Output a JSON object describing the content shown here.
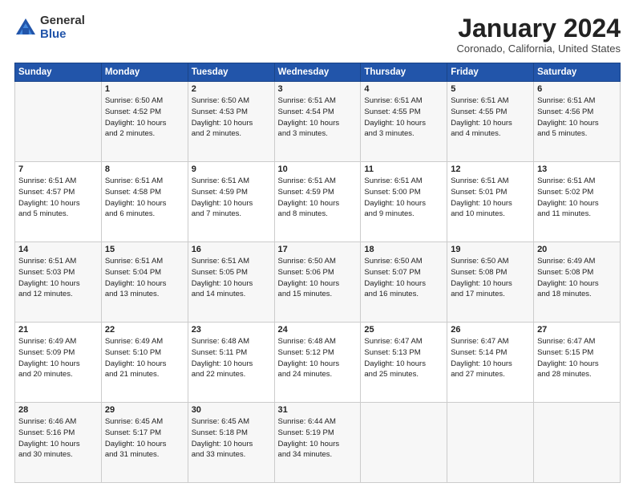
{
  "logo": {
    "general": "General",
    "blue": "Blue"
  },
  "title": "January 2024",
  "location": "Coronado, California, United States",
  "days_header": [
    "Sunday",
    "Monday",
    "Tuesday",
    "Wednesday",
    "Thursday",
    "Friday",
    "Saturday"
  ],
  "weeks": [
    [
      {
        "day": "",
        "info": ""
      },
      {
        "day": "1",
        "info": "Sunrise: 6:50 AM\nSunset: 4:52 PM\nDaylight: 10 hours\nand 2 minutes."
      },
      {
        "day": "2",
        "info": "Sunrise: 6:50 AM\nSunset: 4:53 PM\nDaylight: 10 hours\nand 2 minutes."
      },
      {
        "day": "3",
        "info": "Sunrise: 6:51 AM\nSunset: 4:54 PM\nDaylight: 10 hours\nand 3 minutes."
      },
      {
        "day": "4",
        "info": "Sunrise: 6:51 AM\nSunset: 4:55 PM\nDaylight: 10 hours\nand 3 minutes."
      },
      {
        "day": "5",
        "info": "Sunrise: 6:51 AM\nSunset: 4:55 PM\nDaylight: 10 hours\nand 4 minutes."
      },
      {
        "day": "6",
        "info": "Sunrise: 6:51 AM\nSunset: 4:56 PM\nDaylight: 10 hours\nand 5 minutes."
      }
    ],
    [
      {
        "day": "7",
        "info": "Sunrise: 6:51 AM\nSunset: 4:57 PM\nDaylight: 10 hours\nand 5 minutes."
      },
      {
        "day": "8",
        "info": "Sunrise: 6:51 AM\nSunset: 4:58 PM\nDaylight: 10 hours\nand 6 minutes."
      },
      {
        "day": "9",
        "info": "Sunrise: 6:51 AM\nSunset: 4:59 PM\nDaylight: 10 hours\nand 7 minutes."
      },
      {
        "day": "10",
        "info": "Sunrise: 6:51 AM\nSunset: 4:59 PM\nDaylight: 10 hours\nand 8 minutes."
      },
      {
        "day": "11",
        "info": "Sunrise: 6:51 AM\nSunset: 5:00 PM\nDaylight: 10 hours\nand 9 minutes."
      },
      {
        "day": "12",
        "info": "Sunrise: 6:51 AM\nSunset: 5:01 PM\nDaylight: 10 hours\nand 10 minutes."
      },
      {
        "day": "13",
        "info": "Sunrise: 6:51 AM\nSunset: 5:02 PM\nDaylight: 10 hours\nand 11 minutes."
      }
    ],
    [
      {
        "day": "14",
        "info": "Sunrise: 6:51 AM\nSunset: 5:03 PM\nDaylight: 10 hours\nand 12 minutes."
      },
      {
        "day": "15",
        "info": "Sunrise: 6:51 AM\nSunset: 5:04 PM\nDaylight: 10 hours\nand 13 minutes."
      },
      {
        "day": "16",
        "info": "Sunrise: 6:51 AM\nSunset: 5:05 PM\nDaylight: 10 hours\nand 14 minutes."
      },
      {
        "day": "17",
        "info": "Sunrise: 6:50 AM\nSunset: 5:06 PM\nDaylight: 10 hours\nand 15 minutes."
      },
      {
        "day": "18",
        "info": "Sunrise: 6:50 AM\nSunset: 5:07 PM\nDaylight: 10 hours\nand 16 minutes."
      },
      {
        "day": "19",
        "info": "Sunrise: 6:50 AM\nSunset: 5:08 PM\nDaylight: 10 hours\nand 17 minutes."
      },
      {
        "day": "20",
        "info": "Sunrise: 6:49 AM\nSunset: 5:08 PM\nDaylight: 10 hours\nand 18 minutes."
      }
    ],
    [
      {
        "day": "21",
        "info": "Sunrise: 6:49 AM\nSunset: 5:09 PM\nDaylight: 10 hours\nand 20 minutes."
      },
      {
        "day": "22",
        "info": "Sunrise: 6:49 AM\nSunset: 5:10 PM\nDaylight: 10 hours\nand 21 minutes."
      },
      {
        "day": "23",
        "info": "Sunrise: 6:48 AM\nSunset: 5:11 PM\nDaylight: 10 hours\nand 22 minutes."
      },
      {
        "day": "24",
        "info": "Sunrise: 6:48 AM\nSunset: 5:12 PM\nDaylight: 10 hours\nand 24 minutes."
      },
      {
        "day": "25",
        "info": "Sunrise: 6:47 AM\nSunset: 5:13 PM\nDaylight: 10 hours\nand 25 minutes."
      },
      {
        "day": "26",
        "info": "Sunrise: 6:47 AM\nSunset: 5:14 PM\nDaylight: 10 hours\nand 27 minutes."
      },
      {
        "day": "27",
        "info": "Sunrise: 6:47 AM\nSunset: 5:15 PM\nDaylight: 10 hours\nand 28 minutes."
      }
    ],
    [
      {
        "day": "28",
        "info": "Sunrise: 6:46 AM\nSunset: 5:16 PM\nDaylight: 10 hours\nand 30 minutes."
      },
      {
        "day": "29",
        "info": "Sunrise: 6:45 AM\nSunset: 5:17 PM\nDaylight: 10 hours\nand 31 minutes."
      },
      {
        "day": "30",
        "info": "Sunrise: 6:45 AM\nSunset: 5:18 PM\nDaylight: 10 hours\nand 33 minutes."
      },
      {
        "day": "31",
        "info": "Sunrise: 6:44 AM\nSunset: 5:19 PM\nDaylight: 10 hours\nand 34 minutes."
      },
      {
        "day": "",
        "info": ""
      },
      {
        "day": "",
        "info": ""
      },
      {
        "day": "",
        "info": ""
      }
    ]
  ]
}
